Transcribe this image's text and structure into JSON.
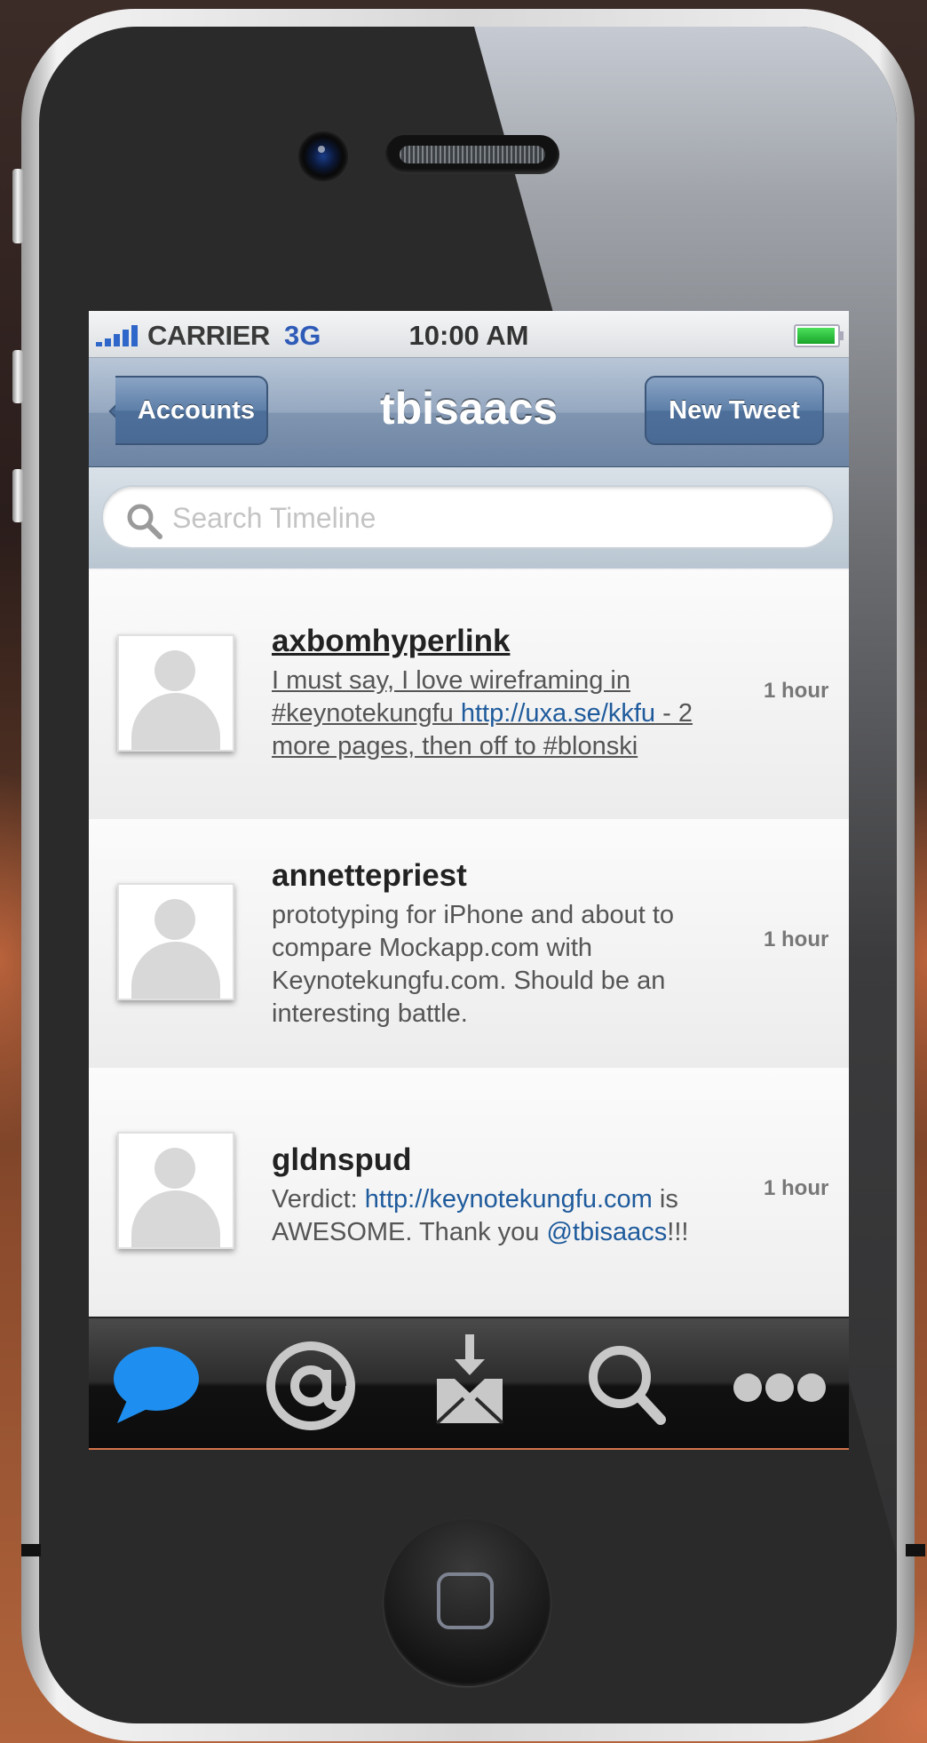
{
  "status_bar": {
    "carrier": "CARRIER",
    "network": "3G",
    "time": "10:00 AM",
    "signal_bars": 5,
    "battery_level": 1.0
  },
  "nav_bar": {
    "back_label": "Accounts",
    "title": "tbisaacs",
    "right_label": "New Tweet"
  },
  "search": {
    "placeholder": "Search Timeline",
    "icon": "magnifier-icon"
  },
  "tweets": [
    {
      "user": "axbomhyperlink",
      "text_before": "I must say, I love wireframing in #keynotekungfu ",
      "link": "http://uxa.se/kkfu",
      "text_after": " - 2 more pages, then off to #blonski",
      "age": "1 hour"
    },
    {
      "user": "annettepriest",
      "text": "prototyping for iPhone and about to compare Mockapp.com with Keynotekungfu.com. Should be an interesting battle.",
      "age": "1 hour"
    },
    {
      "user": "gldnspud",
      "text_before": "Verdict: ",
      "link": "http://keynotekungfu.com",
      "text_middle": " is AWESOME. Thank you ",
      "mention": "@tbisaacs",
      "text_after": "!!!",
      "age": "1 hour"
    }
  ],
  "tab_bar": {
    "tabs": [
      {
        "icon": "speech-bubble-icon",
        "selected": true
      },
      {
        "icon": "at-sign-icon",
        "selected": false
      },
      {
        "icon": "inbox-download-icon",
        "selected": false
      },
      {
        "icon": "search-icon",
        "selected": false
      },
      {
        "icon": "more-icon",
        "selected": false
      }
    ]
  },
  "colors": {
    "nav_bar": "#7f95b0",
    "link": "#1f5b9c",
    "selected_tab": "#1e8ff0",
    "unselected_tab": "#c8c8c8"
  }
}
